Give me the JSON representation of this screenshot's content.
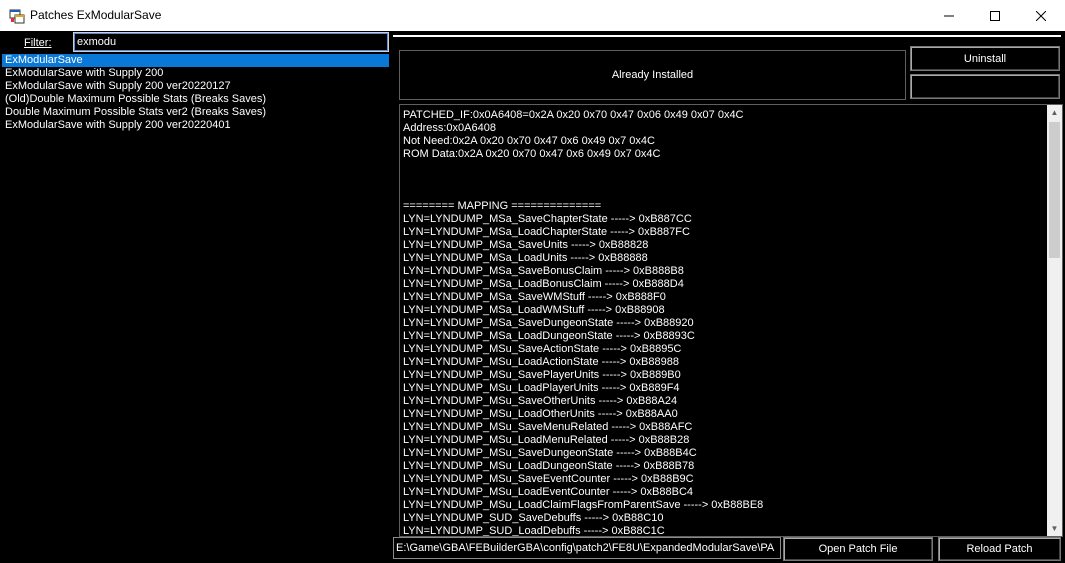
{
  "window": {
    "title": "Patches ExModularSave",
    "icon": "app-window-icon"
  },
  "filter": {
    "label": "Filter:",
    "value": "exmodu"
  },
  "patch_list": {
    "items": [
      {
        "label": "ExModularSave",
        "selected": true
      },
      {
        "label": "ExModularSave with Supply 200",
        "selected": false
      },
      {
        "label": "ExModularSave with Supply 200 ver20220127",
        "selected": false
      },
      {
        "label": "(Old)Double Maximum Possible Stats (Breaks Saves)",
        "selected": false
      },
      {
        "label": "Double Maximum Possible Stats ver2 (Breaks Saves)",
        "selected": false
      },
      {
        "label": "ExModularSave with Supply 200 ver20220401",
        "selected": false
      }
    ]
  },
  "status": {
    "text": "Already Installed"
  },
  "buttons": {
    "uninstall": "Uninstall",
    "blank": "",
    "open_patch_file": "Open Patch File",
    "reload_patch": "Reload Patch"
  },
  "log": {
    "lines": [
      "PATCHED_IF:0x0A6408=0x2A 0x20 0x70 0x47 0x06 0x49 0x07 0x4C",
      "Address:0x0A6408",
      "Not Need:0x2A 0x20 0x70 0x47 0x6 0x49 0x7 0x4C",
      "ROM Data:0x2A 0x20 0x70 0x47 0x6 0x49 0x7 0x4C",
      "",
      "",
      "",
      "======== MAPPING ==============",
      "LYN=LYNDUMP_MSa_SaveChapterState -----> 0xB887CC",
      "LYN=LYNDUMP_MSa_LoadChapterState -----> 0xB887FC",
      "LYN=LYNDUMP_MSa_SaveUnits -----> 0xB88828",
      "LYN=LYNDUMP_MSa_LoadUnits -----> 0xB88888",
      "LYN=LYNDUMP_MSa_SaveBonusClaim -----> 0xB888B8",
      "LYN=LYNDUMP_MSa_LoadBonusClaim -----> 0xB888D4",
      "LYN=LYNDUMP_MSa_SaveWMStuff -----> 0xB888F0",
      "LYN=LYNDUMP_MSa_LoadWMStuff -----> 0xB88908",
      "LYN=LYNDUMP_MSa_SaveDungeonState -----> 0xB88920",
      "LYN=LYNDUMP_MSa_LoadDungeonState -----> 0xB8893C",
      "LYN=LYNDUMP_MSu_SaveActionState -----> 0xB8895C",
      "LYN=LYNDUMP_MSu_LoadActionState -----> 0xB88988",
      "LYN=LYNDUMP_MSu_SavePlayerUnits -----> 0xB889B0",
      "LYN=LYNDUMP_MSu_LoadPlayerUnits -----> 0xB889F4",
      "LYN=LYNDUMP_MSu_SaveOtherUnits -----> 0xB88A24",
      "LYN=LYNDUMP_MSu_LoadOtherUnits -----> 0xB88AA0",
      "LYN=LYNDUMP_MSu_SaveMenuRelated -----> 0xB88AFC",
      "LYN=LYNDUMP_MSu_LoadMenuRelated -----> 0xB88B28",
      "LYN=LYNDUMP_MSu_SaveDungeonState -----> 0xB88B4C",
      "LYN=LYNDUMP_MSu_LoadDungeonState -----> 0xB88B78",
      "LYN=LYNDUMP_MSu_SaveEventCounter -----> 0xB88B9C",
      "LYN=LYNDUMP_MSu_LoadEventCounter -----> 0xB88BC4",
      "LYN=LYNDUMP_MSu_LoadClaimFlagsFromParentSave -----> 0xB88BE8",
      "LYN=LYNDUMP_SUD_SaveDebuffs -----> 0xB88C10",
      "LYN=LYNDUMP_SUD_LoadDebuffs -----> 0xB88C1C"
    ]
  },
  "path": {
    "value": "E:\\Game\\GBA\\FEBuilderGBA\\config\\patch2\\FE8U\\ExpandedModularSave\\PA"
  },
  "colors": {
    "background": "#000000",
    "selection": "#0a78d7",
    "text": "#ffffff"
  }
}
